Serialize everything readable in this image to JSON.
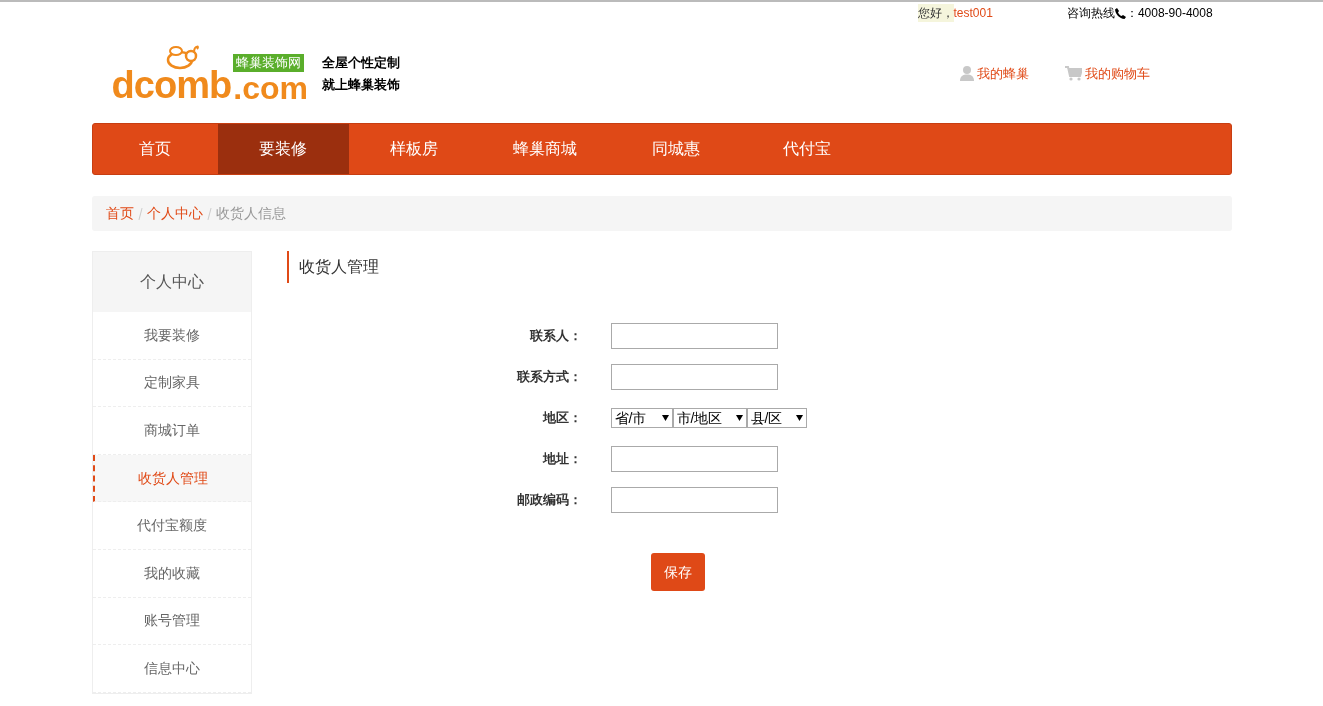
{
  "top_bar": {
    "greeting": "您好，",
    "username": "test001",
    "hotline_label": "咨询热线",
    "hotline_number": "：4008-90-4008"
  },
  "logo": {
    "word": "dcomb",
    "domain": ".com",
    "badge": "蜂巢装饰网"
  },
  "slogan": [
    "全屋个性定制",
    "就上蜂巢装饰"
  ],
  "header_links": [
    {
      "kind": "user",
      "label": "我的蜂巢"
    },
    {
      "kind": "cart",
      "label": "我的购物车"
    }
  ],
  "nav": [
    {
      "label": "首页",
      "selected": false
    },
    {
      "label": "要装修",
      "selected": true
    },
    {
      "label": "样板房",
      "selected": false
    },
    {
      "label": "蜂巢商城",
      "selected": false
    },
    {
      "label": "同城惠",
      "selected": false
    },
    {
      "label": "代付宝",
      "selected": false
    }
  ],
  "breadcrumb": [
    {
      "label": "首页",
      "link": true
    },
    {
      "label": "个人中心",
      "link": true
    },
    {
      "label": "收货人信息",
      "link": false
    }
  ],
  "sidebar": {
    "title": "个人中心",
    "items": [
      {
        "label": "我要装修",
        "selected": false
      },
      {
        "label": "定制家具",
        "selected": false
      },
      {
        "label": "商城订单",
        "selected": false
      },
      {
        "label": "收货人管理",
        "selected": true
      },
      {
        "label": "代付宝额度",
        "selected": false
      },
      {
        "label": "我的收藏",
        "selected": false
      },
      {
        "label": "账号管理",
        "selected": false
      },
      {
        "label": "信息中心",
        "selected": false
      }
    ]
  },
  "content": {
    "title": "收货人管理",
    "fields": [
      {
        "kind": "text",
        "label": "联系人："
      },
      {
        "kind": "text",
        "label": "联系方式："
      },
      {
        "kind": "selects",
        "label": "地区：",
        "options": [
          "省/市",
          "市/地区",
          "县/区"
        ]
      },
      {
        "kind": "text",
        "label": "地址："
      },
      {
        "kind": "text",
        "label": "邮政编码："
      }
    ],
    "save_button": "保存"
  }
}
